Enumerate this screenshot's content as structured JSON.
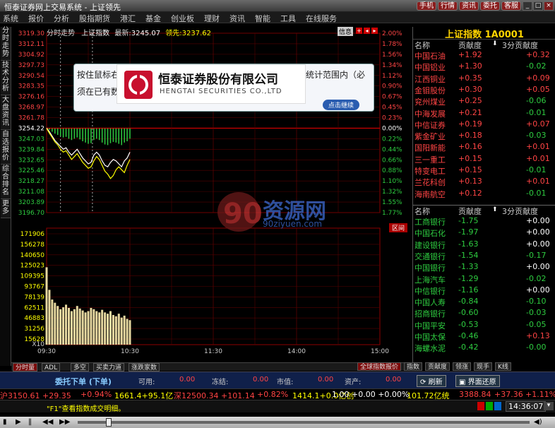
{
  "window": {
    "title": "恒泰证券网上交易系统 - 上证领先",
    "quick_buttons": [
      "手机",
      "行情",
      "资讯",
      "委托",
      "客服"
    ]
  },
  "menu": [
    "系统",
    "报价",
    "分析",
    "股指期货",
    "港汇",
    "基金",
    "创业板",
    "理财",
    "资讯",
    "智能",
    "工具",
    "在线服务"
  ],
  "left_tabs": [
    "分时走势",
    "技术分析",
    "大盘资讯",
    "自选报价",
    "综合排名",
    "更多"
  ],
  "chart_header": {
    "label": "分时走势",
    "index_name": "上证指数",
    "latest_label": "最新:",
    "latest": "3245.07",
    "lead_label": "领先:",
    "lead": "3237.62",
    "info_btn": "信息"
  },
  "chart_data": {
    "type": "line",
    "title": "上证指数 分时走势",
    "prev_close": 3254.22,
    "price_ticks": [
      "3319.30",
      "3312.11",
      "3304.92",
      "3297.73",
      "3290.54",
      "3283.35",
      "3276.16",
      "3268.97",
      "3261.78",
      "3254.22",
      "3247.03",
      "3239.84",
      "3232.65",
      "3225.46",
      "3218.27",
      "3211.08",
      "3203.89",
      "3196.70"
    ],
    "pct_ticks": [
      "2.00%",
      "1.78%",
      "1.56%",
      "1.34%",
      "1.12%",
      "0.90%",
      "0.67%",
      "0.45%",
      "0.23%",
      "0.00%",
      "0.22%",
      "0.44%",
      "0.66%",
      "0.88%",
      "1.10%",
      "1.32%",
      "1.55%",
      "1.77%"
    ],
    "x_ticks": [
      "09:30",
      "10:30",
      "11:30",
      "14:00",
      "15:00"
    ],
    "volume_ticks": [
      "171906",
      "156278",
      "140650",
      "125023",
      "109395",
      "93767",
      "78139",
      "62511",
      "46883",
      "31256",
      "15628"
    ],
    "volume_unit": "X10",
    "x": [
      0,
      2,
      4,
      6,
      8,
      10,
      12,
      14,
      16,
      18,
      20,
      22,
      24,
      26,
      28,
      30,
      32,
      34,
      36,
      38,
      40,
      42,
      44,
      46,
      48,
      50,
      52,
      54,
      56,
      58,
      60
    ],
    "series": [
      {
        "name": "上证指数",
        "color": "#ffffff",
        "values": [
          3254.5,
          3252,
          3249,
          3246,
          3244,
          3242,
          3240,
          3241,
          3238,
          3236,
          3238,
          3240,
          3237,
          3234,
          3232,
          3230,
          3231,
          3236,
          3238,
          3236,
          3232,
          3229,
          3228,
          3231,
          3233,
          3232,
          3230,
          3228,
          3232,
          3234,
          3238
        ]
      },
      {
        "name": "领先",
        "color": "#ffff00",
        "values": [
          3254.3,
          3251,
          3248,
          3245,
          3243,
          3240,
          3238,
          3239,
          3236,
          3233,
          3235,
          3237,
          3234,
          3231,
          3229,
          3227,
          3228,
          3232,
          3235,
          3233,
          3229,
          3225,
          3223,
          3220,
          3222,
          3226,
          3228,
          3226,
          3224,
          3229,
          3233
        ]
      }
    ],
    "volume": [
      120000,
      85000,
      70000,
      65000,
      60000,
      55000,
      58000,
      62000,
      57000,
      52000,
      55000,
      60000,
      56000,
      53000,
      50000,
      52000,
      57000,
      55000,
      52000,
      50000,
      54000,
      50000,
      48000,
      52000,
      46000,
      44000,
      48000,
      42000,
      45000,
      40000,
      38000
    ],
    "ylim": [
      3196.7,
      3319.3
    ]
  },
  "range_btn": "区间",
  "right_panel": {
    "title": "上证指数 1A0001",
    "headers": [
      "名称",
      "贡献度",
      "3分贡献度"
    ],
    "top": [
      {
        "name": "中国石油",
        "c": "+1.92",
        "c3": "+0.32"
      },
      {
        "name": "中国铝业",
        "c": "+1.30",
        "c3": "-0.02"
      },
      {
        "name": "江西铜业",
        "c": "+0.35",
        "c3": "+0.09"
      },
      {
        "name": "金钼股份",
        "c": "+0.30",
        "c3": "+0.05"
      },
      {
        "name": "兖州煤业",
        "c": "+0.25",
        "c3": "-0.06"
      },
      {
        "name": "中海发展",
        "c": "+0.21",
        "c3": "-0.01"
      },
      {
        "name": "中信证券",
        "c": "+0.19",
        "c3": "+0.07"
      },
      {
        "name": "紫金矿业",
        "c": "+0.18",
        "c3": "-0.03"
      },
      {
        "name": "国阳新能",
        "c": "+0.16",
        "c3": "+0.01"
      },
      {
        "name": "三一重工",
        "c": "+0.15",
        "c3": "+0.01"
      },
      {
        "name": "特变电工",
        "c": "+0.15",
        "c3": "-0.01"
      },
      {
        "name": "兰花科创",
        "c": "+0.13",
        "c3": "+0.01"
      },
      {
        "name": "海南航空",
        "c": "+0.12",
        "c3": "-0.01"
      }
    ],
    "bottom": [
      {
        "name": "工商银行",
        "c": "-1.75",
        "c3": "+0.00"
      },
      {
        "name": "中国石化",
        "c": "-1.97",
        "c3": "+0.00"
      },
      {
        "name": "建设银行",
        "c": "-1.63",
        "c3": "+0.00"
      },
      {
        "name": "交通银行",
        "c": "-1.54",
        "c3": "-0.17"
      },
      {
        "name": "中国银行",
        "c": "-1.33",
        "c3": "+0.00"
      },
      {
        "name": "上海汽车",
        "c": "-1.29",
        "c3": "-0.02"
      },
      {
        "name": "中信银行",
        "c": "-1.16",
        "c3": "+0.00"
      },
      {
        "name": "中国人寿",
        "c": "-0.84",
        "c3": "-0.10"
      },
      {
        "name": "招商银行",
        "c": "-0.60",
        "c3": "-0.03"
      },
      {
        "name": "中国平安",
        "c": "-0.53",
        "c3": "-0.05"
      },
      {
        "name": "中国太保",
        "c": "-0.46",
        "c3": "+0.13"
      },
      {
        "name": "海螺水泥",
        "c": "-0.42",
        "c3": "-0.00"
      }
    ]
  },
  "bottom_tabs": [
    "分时量",
    "ADL",
    "多空",
    "买卖力道",
    "涨跌家数"
  ],
  "right_tabs": [
    "全球指数报价",
    "指数",
    "贡献度",
    "领涨",
    "现手",
    "K线"
  ],
  "order": {
    "title": "委托下单 (下单)",
    "fields": [
      {
        "label": "可用:",
        "value": "0.00"
      },
      {
        "label": "冻结:",
        "value": "0.00"
      },
      {
        "label": "市值:",
        "value": "0.00"
      },
      {
        "label": "资产:",
        "value": "0.00"
      }
    ],
    "refresh": "刷新",
    "restore": "界面还原"
  },
  "ticker": {
    "sh": "沪3150.61 +29.35",
    "sh_pct": "+0.94%",
    "sh_vol": "1661.4+95.1亿",
    "sz": "深12500.34 +101.14",
    "sz_pct": "+0.82%",
    "sz_vol": "1414.1+0.0亿创",
    "cy": "1.00 +0.00 +0.00%",
    "zx": "101.72亿统",
    "zx_val": "3388.84",
    "zx_chg": "+37.36",
    "zx_pct": "+1.11%"
  },
  "status": {
    "tip": "\"F1\"查看指数成交明细。",
    "time": "14:36:07"
  },
  "popup": {
    "text1": "按住鼠标右",
    "text2": "须在已有数",
    "text3": "统计范围内（必",
    "brand_cn": "恒泰证券股份有限公司",
    "brand_en": "HENGTAI SECURITIES CO.,LTD",
    "btn": "点击继续"
  },
  "watermark": {
    "big": "资源网",
    "url": "90ziyuen.com"
  }
}
